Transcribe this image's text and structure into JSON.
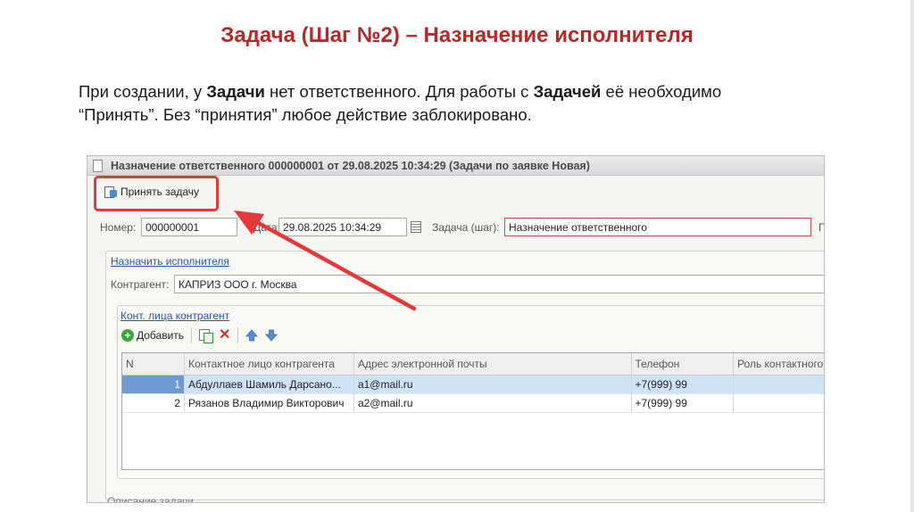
{
  "slide": {
    "title": "Задача (Шаг №2) – Назначение исполнителя",
    "intro_1": "При создании, у ",
    "intro_b1": "Задачи",
    "intro_2": " нет ответственного. Для работы с ",
    "intro_b2": "Задачей",
    "intro_3": " её необходимо “Принять”. Без “принятия” любое действие заблокировано."
  },
  "window": {
    "title": "Назначение ответственного 000000001 от 29.08.2025 10:34:29 (Задачи по заявке Новая)",
    "accept_button": "Принять задачу",
    "number_label": "Номер:",
    "number_value": "000000001",
    "date_label": "Дата:",
    "date_value": "29.08.2025 10:34:29",
    "task_label": "Задача (шаг):",
    "task_value": "Назначение ответственного",
    "cut_label": "П",
    "assign_link": "Назначить исполнителя",
    "counterparty_label": "Контрагент:",
    "counterparty_value": "КАПРИЗ ООО г. Москва",
    "contacts_link": "Конт. лица контрагент",
    "add_button": "Добавить",
    "bottom_label": "Описание задачи"
  },
  "table": {
    "columns": [
      "N",
      "Контактное лицо контрагента",
      "Адрес электронной почты",
      "Телефон",
      "Роль контактного"
    ],
    "rows": [
      {
        "n": "1",
        "name": "Абдуллаев Шамиль Дарсано...",
        "email": "a1@mail.ru",
        "phone": "+7(999) 99",
        "role": ""
      },
      {
        "n": "2",
        "name": "Рязанов Владимир Викторович",
        "email": "a2@mail.ru",
        "phone": "+7(999) 99",
        "role": ""
      }
    ]
  },
  "colors": {
    "title": "#b22a2a",
    "highlight": "#e23a3a",
    "selected_row": "#cfe3f8"
  }
}
